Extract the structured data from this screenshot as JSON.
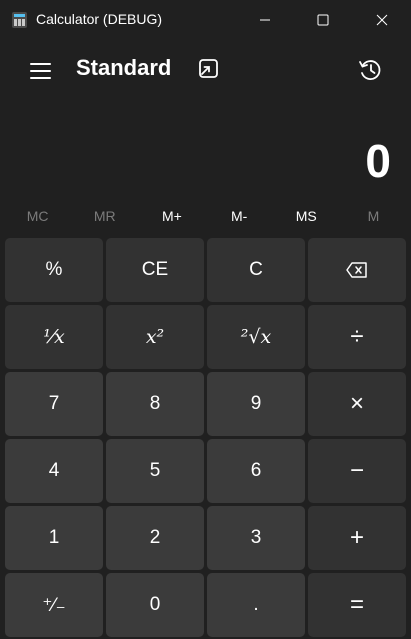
{
  "window": {
    "title": "Calculator (DEBUG)"
  },
  "header": {
    "mode": "Standard"
  },
  "display": {
    "value": "0"
  },
  "memory": [
    {
      "label": "MC",
      "enabled": false
    },
    {
      "label": "MR",
      "enabled": false
    },
    {
      "label": "M+",
      "enabled": true
    },
    {
      "label": "M-",
      "enabled": true
    },
    {
      "label": "MS",
      "enabled": true
    },
    {
      "label": "M",
      "enabled": false
    }
  ],
  "keys": {
    "percent": "%",
    "clear_entry": "CE",
    "clear": "C",
    "reciprocal": "¹⁄x",
    "square": "x²",
    "sqrt": "²√x",
    "divide": "÷",
    "seven": "7",
    "eight": "8",
    "nine": "9",
    "multiply": "×",
    "four": "4",
    "five": "5",
    "six": "6",
    "minus": "−",
    "one": "1",
    "two": "2",
    "three": "3",
    "plus": "+",
    "negate": "⁺⁄₋",
    "zero": "0",
    "decimal": ".",
    "equals": "="
  },
  "icons": {
    "hamburger": "hamburger-menu-icon",
    "keep_on_top": "keep-on-top-icon",
    "history": "history-icon",
    "backspace": "backspace-icon"
  }
}
